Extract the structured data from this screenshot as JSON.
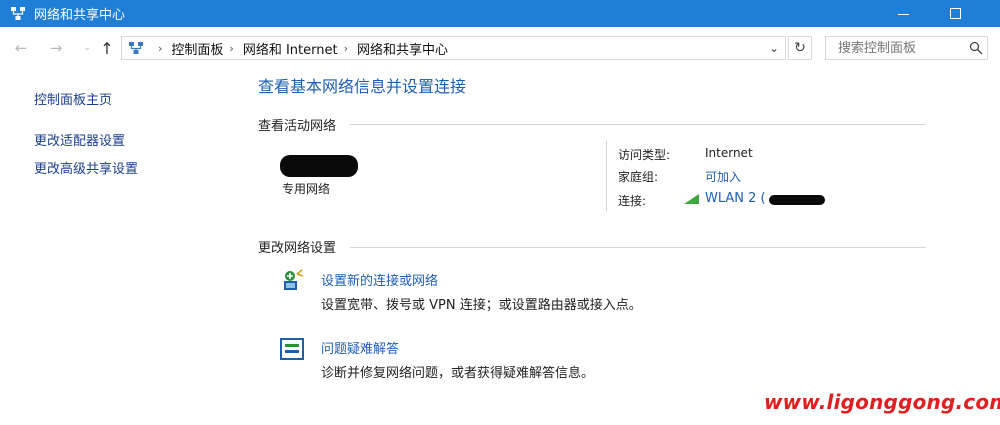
{
  "window": {
    "title": "网络和共享中心",
    "accent_color": "#1f7ed6",
    "app_icon": "network-sharing-icon"
  },
  "address_bar": {
    "breadcrumbs": [
      "控制面板",
      "网络和 Internet",
      "网络和共享中心"
    ],
    "search_placeholder": "搜索控制面板"
  },
  "sidebar": {
    "items": [
      {
        "label": "控制面板主页"
      },
      {
        "label": "更改适配器设置"
      },
      {
        "label": "更改高级共享设置"
      }
    ]
  },
  "main": {
    "title": "查看基本网络信息并设置连接",
    "active_networks": {
      "header": "查看活动网络",
      "network_type": "专用网络",
      "access_type_label": "访问类型:",
      "access_type_value": "Internet",
      "homegroup_label": "家庭组:",
      "homegroup_value": "可加入",
      "connection_label": "连接:",
      "connection_value": "WLAN 2 ("
    },
    "change_settings": {
      "header": "更改网络设置",
      "tasks": [
        {
          "title": "设置新的连接或网络",
          "desc": "设置宽带、拨号或 VPN 连接；或设置路由器或接入点。",
          "icon": "new-connection-icon"
        },
        {
          "title": "问题疑难解答",
          "desc": "诊断并修复网络问题，或者获得疑难解答信息。",
          "icon": "troubleshoot-icon"
        }
      ]
    }
  },
  "watermark": "www.ligonggong.com"
}
